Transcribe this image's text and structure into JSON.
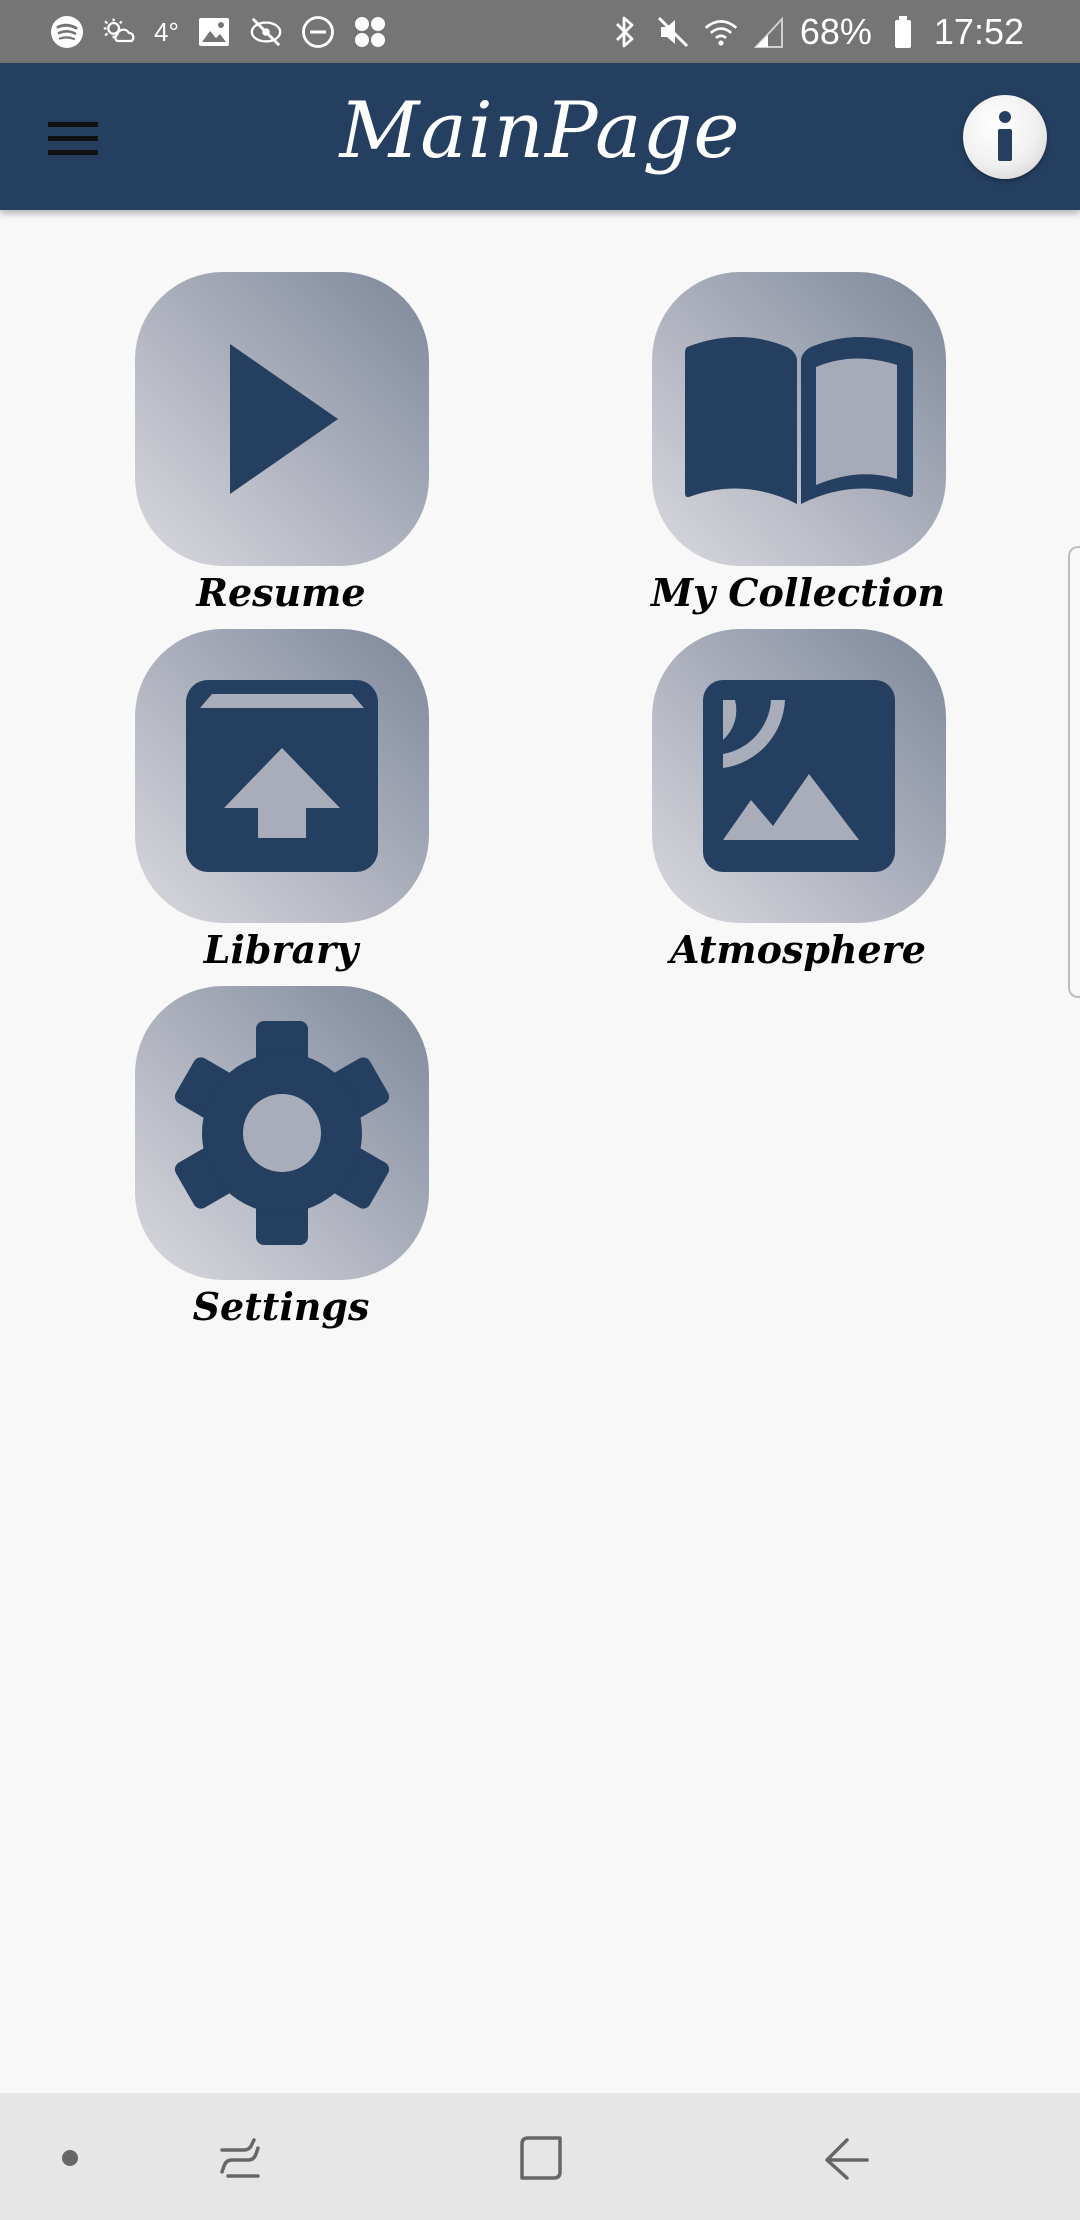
{
  "status_bar": {
    "temperature": "4°",
    "battery": "68%",
    "time": "17:52",
    "icons_left": [
      "spotify-icon",
      "weather-icon",
      "image-icon",
      "eye-off-icon",
      "do-not-disturb-icon",
      "apps-icon"
    ],
    "icons_right": [
      "bluetooth-icon",
      "mute-icon",
      "wifi-icon",
      "signal-icon",
      "battery-icon"
    ]
  },
  "app_bar": {
    "title": "MainPage",
    "menu_icon": "hamburger-menu-icon",
    "info_icon": "info-icon"
  },
  "tiles": [
    {
      "id": "resume",
      "label": "Resume",
      "icon": "play-icon"
    },
    {
      "id": "my-collection",
      "label": "My Collection",
      "icon": "book-icon"
    },
    {
      "id": "library",
      "label": "Library",
      "icon": "archive-upload-icon"
    },
    {
      "id": "atmosphere",
      "label": "Atmosphere",
      "icon": "landscape-icon"
    },
    {
      "id": "settings",
      "label": "Settings",
      "icon": "gear-icon"
    }
  ],
  "colors": {
    "primary": "#253f61",
    "status_bar": "#757575",
    "background": "#f8f8f8",
    "nav_bar": "#e6e6e6"
  },
  "nav_bar": {
    "buttons": [
      "dot-icon",
      "recents-icon",
      "home-icon",
      "back-icon"
    ]
  }
}
